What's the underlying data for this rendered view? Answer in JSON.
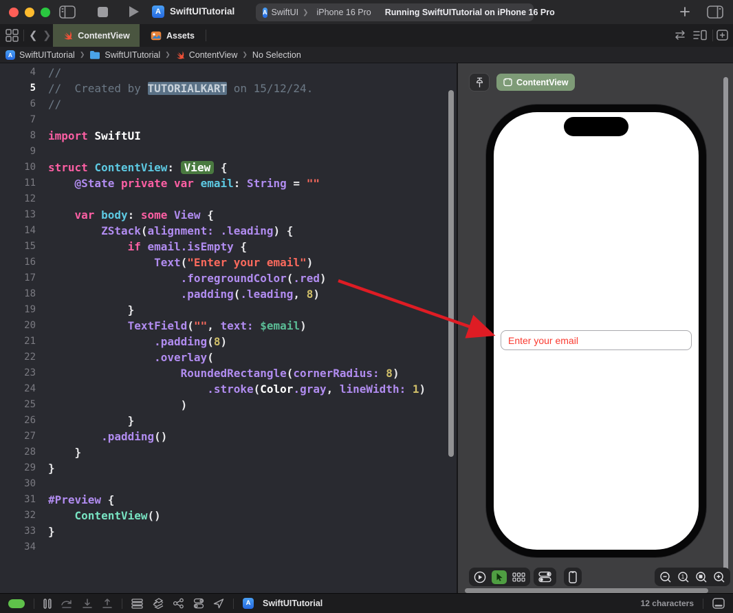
{
  "titlebar": {
    "title": "SwiftUITutorial",
    "scheme": "SwiftUI",
    "chevron": "❯",
    "device": "iPhone 16 Pro",
    "status": "Running SwiftUITutorial on iPhone 16 Pro",
    "app_badge": "A"
  },
  "tabbar": {
    "tabs": [
      {
        "label": "ContentView",
        "active": true
      },
      {
        "label": "Assets",
        "active": false
      }
    ]
  },
  "breadcrumb": {
    "items": [
      "SwiftUITutorial",
      "SwiftUITutorial",
      "ContentView",
      "No Selection"
    ]
  },
  "editor": {
    "lines": [
      {
        "n": 4,
        "t": [
          [
            "com",
            "//"
          ]
        ]
      },
      {
        "n": 5,
        "cur": true,
        "t": [
          [
            "com",
            "//  Created by "
          ],
          [
            "hl",
            "TUTORIALKART"
          ],
          [
            "com",
            " on 15/12/24."
          ]
        ]
      },
      {
        "n": 6,
        "t": [
          [
            "com",
            "//"
          ]
        ]
      },
      {
        "n": 7,
        "t": []
      },
      {
        "n": 8,
        "t": [
          [
            "kw",
            "import "
          ],
          [
            "whb",
            "SwiftUI"
          ]
        ]
      },
      {
        "n": 9,
        "t": []
      },
      {
        "n": 10,
        "t": [
          [
            "kw",
            "struct "
          ],
          [
            "dec",
            "ContentView"
          ],
          [
            "wh",
            ": "
          ],
          [
            "badge",
            "View"
          ],
          [
            "wh",
            " {"
          ]
        ]
      },
      {
        "n": 11,
        "t": [
          [
            "wh",
            "    "
          ],
          [
            "typ",
            "@State "
          ],
          [
            "kw",
            "private "
          ],
          [
            "kw",
            "var "
          ],
          [
            "dec",
            "email"
          ],
          [
            "wh",
            ": "
          ],
          [
            "typ",
            "String"
          ],
          [
            "wh",
            " = "
          ],
          [
            "str",
            "\"\""
          ]
        ]
      },
      {
        "n": 12,
        "t": []
      },
      {
        "n": 13,
        "t": [
          [
            "wh",
            "    "
          ],
          [
            "kw",
            "var "
          ],
          [
            "dec",
            "body"
          ],
          [
            "wh",
            ": "
          ],
          [
            "kw",
            "some "
          ],
          [
            "typ",
            "View"
          ],
          [
            "wh",
            " {"
          ]
        ]
      },
      {
        "n": 14,
        "t": [
          [
            "wh",
            "        "
          ],
          [
            "typ",
            "ZStack"
          ],
          [
            "wh",
            "("
          ],
          [
            "typ",
            "alignment:"
          ],
          [
            "wh",
            " "
          ],
          [
            "typ",
            ".leading"
          ],
          [
            "wh",
            ") {"
          ]
        ]
      },
      {
        "n": 15,
        "t": [
          [
            "wh",
            "            "
          ],
          [
            "kw",
            "if "
          ],
          [
            "typ",
            "email.isEmpty"
          ],
          [
            "wh",
            " {"
          ]
        ]
      },
      {
        "n": 16,
        "t": [
          [
            "wh",
            "                "
          ],
          [
            "typ",
            "Text"
          ],
          [
            "wh",
            "("
          ],
          [
            "str",
            "\"Enter your email\""
          ],
          [
            "wh",
            ")"
          ]
        ]
      },
      {
        "n": 17,
        "t": [
          [
            "wh",
            "                    "
          ],
          [
            "typ",
            ".foregroundColor"
          ],
          [
            "wh",
            "("
          ],
          [
            "typ",
            ".red"
          ],
          [
            "wh",
            ")"
          ]
        ]
      },
      {
        "n": 18,
        "t": [
          [
            "wh",
            "                    "
          ],
          [
            "typ",
            ".padding"
          ],
          [
            "wh",
            "("
          ],
          [
            "typ",
            ".leading"
          ],
          [
            "wh",
            ", "
          ],
          [
            "num",
            "8"
          ],
          [
            "wh",
            ")"
          ]
        ]
      },
      {
        "n": 19,
        "t": [
          [
            "wh",
            "            }"
          ]
        ]
      },
      {
        "n": 20,
        "t": [
          [
            "wh",
            "            "
          ],
          [
            "typ",
            "TextField"
          ],
          [
            "wh",
            "("
          ],
          [
            "str",
            "\"\""
          ],
          [
            "wh",
            ", "
          ],
          [
            "typ",
            "text:"
          ],
          [
            "wh",
            " "
          ],
          [
            "mint",
            "$email"
          ],
          [
            "wh",
            ")"
          ]
        ]
      },
      {
        "n": 21,
        "t": [
          [
            "wh",
            "                "
          ],
          [
            "typ",
            ".padding"
          ],
          [
            "wh",
            "("
          ],
          [
            "num",
            "8"
          ],
          [
            "wh",
            ")"
          ]
        ]
      },
      {
        "n": 22,
        "t": [
          [
            "wh",
            "                "
          ],
          [
            "typ",
            ".overlay"
          ],
          [
            "wh",
            "("
          ]
        ]
      },
      {
        "n": 23,
        "t": [
          [
            "wh",
            "                    "
          ],
          [
            "typ",
            "RoundedRectangle"
          ],
          [
            "wh",
            "("
          ],
          [
            "typ",
            "cornerRadius:"
          ],
          [
            "wh",
            " "
          ],
          [
            "num",
            "8"
          ],
          [
            "wh",
            ")"
          ]
        ]
      },
      {
        "n": 24,
        "t": [
          [
            "wh",
            "                        "
          ],
          [
            "typ",
            ".stroke"
          ],
          [
            "wh",
            "("
          ],
          [
            "whb",
            "Color"
          ],
          [
            "typ",
            ".gray"
          ],
          [
            "wh",
            ", "
          ],
          [
            "typ",
            "lineWidth:"
          ],
          [
            "wh",
            " "
          ],
          [
            "num",
            "1"
          ],
          [
            "wh",
            ")"
          ]
        ]
      },
      {
        "n": 25,
        "t": [
          [
            "wh",
            "                    )"
          ]
        ]
      },
      {
        "n": 26,
        "t": [
          [
            "wh",
            "            }"
          ]
        ]
      },
      {
        "n": 27,
        "t": [
          [
            "wh",
            "        "
          ],
          [
            "typ",
            ".padding"
          ],
          [
            "wh",
            "()"
          ]
        ]
      },
      {
        "n": 28,
        "t": [
          [
            "wh",
            "    }"
          ]
        ]
      },
      {
        "n": 29,
        "t": [
          [
            "wh",
            "}"
          ]
        ]
      },
      {
        "n": 30,
        "t": []
      },
      {
        "n": 31,
        "t": [
          [
            "typ",
            "#Preview"
          ],
          [
            "wh",
            " {"
          ]
        ]
      },
      {
        "n": 32,
        "t": [
          [
            "wh",
            "    "
          ],
          [
            "mintb",
            "ContentView"
          ],
          [
            "wh",
            "()"
          ]
        ]
      },
      {
        "n": 33,
        "t": [
          [
            "wh",
            "}"
          ]
        ]
      },
      {
        "n": 34,
        "t": []
      }
    ]
  },
  "preview": {
    "pill_label": "ContentView",
    "textfield_text": "Enter your email"
  },
  "statusbar": {
    "project": "SwiftUITutorial",
    "app_badge": "A",
    "char_count": "12 characters"
  },
  "icons": [
    "sidebar-toggle-icon",
    "stop-icon",
    "play-icon",
    "xcode-project-icon",
    "plus-icon",
    "inspector-toggle-icon",
    "editor-grid-icon",
    "back-chevron-icon",
    "forward-chevron-icon",
    "swift-icon",
    "assets-icon",
    "swap-icon",
    "minimap-icon",
    "add-editor-icon",
    "folder-icon",
    "pin-icon",
    "preview-device-icon",
    "play-circle-icon",
    "cursor-icon",
    "variants-grid-icon",
    "device-settings-icon",
    "phone-icon",
    "zoom-out-icon",
    "zoom-100-icon",
    "zoom-fit-icon",
    "zoom-in-icon",
    "pause-icon",
    "step-over-icon",
    "step-into-icon",
    "step-out-icon",
    "view-debugger-icon",
    "memory-graph-icon",
    "network-icon",
    "environment-overrides-icon",
    "location-icon",
    "console-toggle-icon"
  ],
  "colors": {
    "tab_active_bg": "#4a5540",
    "preview_pill_bg": "#7e9b77",
    "arrow_red": "#de1c24",
    "textfield_red": "#fa3a30",
    "app_icon_blue": "#3478f6",
    "swift_orange": "#f05138",
    "breakpoint_green": "#5fc14a",
    "editor_bg": "#292a30"
  }
}
